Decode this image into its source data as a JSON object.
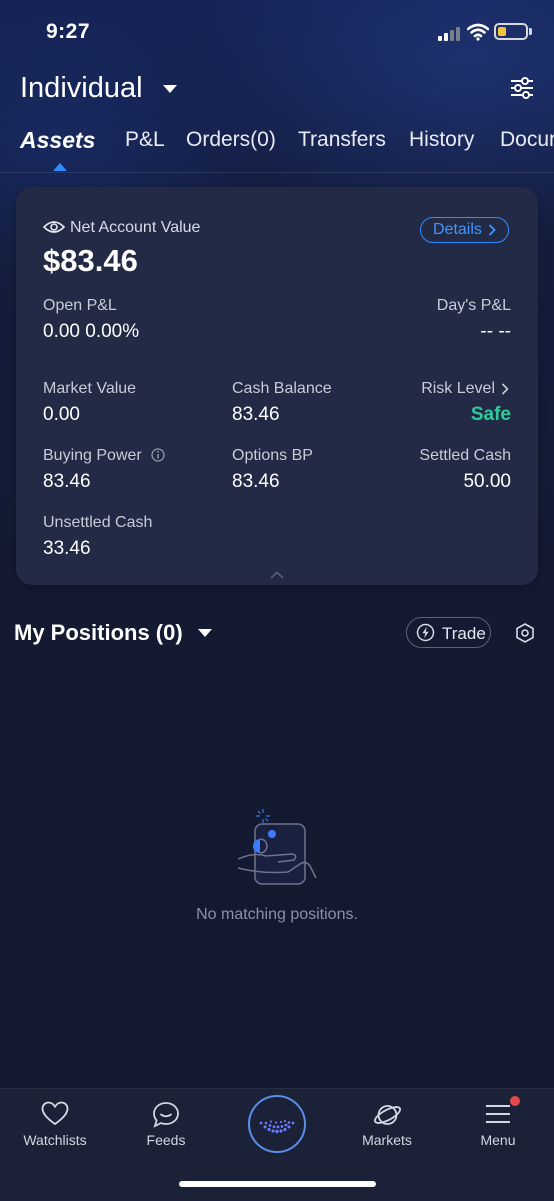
{
  "status_bar": {
    "time": "9:27"
  },
  "header": {
    "account_name": "Individual"
  },
  "tabs": [
    {
      "label": "Assets",
      "active": true
    },
    {
      "label": "P&L"
    },
    {
      "label": "Orders(0)"
    },
    {
      "label": "Transfers"
    },
    {
      "label": "History"
    },
    {
      "label": "Docur"
    }
  ],
  "account_card": {
    "net_value_label": "Net Account Value",
    "net_value": "$83.46",
    "details_label": "Details",
    "open_pl_label": "Open P&L",
    "open_pl_value": "0.00 0.00%",
    "days_pl_label": "Day's P&L",
    "days_pl_value": "-- --",
    "market_value_label": "Market Value",
    "market_value": "0.00",
    "cash_balance_label": "Cash Balance",
    "cash_balance": "83.46",
    "risk_level_label": "Risk Level",
    "risk_level": "Safe",
    "buying_power_label": "Buying Power",
    "buying_power": "83.46",
    "options_bp_label": "Options BP",
    "options_bp": "83.46",
    "settled_cash_label": "Settled Cash",
    "settled_cash": "50.00",
    "unsettled_cash_label": "Unsettled Cash",
    "unsettled_cash": "33.46"
  },
  "positions": {
    "title": "My Positions (0)",
    "trade_label": "Trade",
    "empty_message": "No matching positions."
  },
  "bottom_nav": [
    {
      "label": "Watchlists",
      "icon": "heart-icon"
    },
    {
      "label": "Feeds",
      "icon": "chat-bubble-icon"
    },
    {
      "label": "",
      "icon": "center-logo-icon"
    },
    {
      "label": "Markets",
      "icon": "planet-icon"
    },
    {
      "label": "Menu",
      "icon": "hamburger-menu-icon",
      "notification_dot": true
    }
  ],
  "colors": {
    "accent": "#2f8cff",
    "safe": "#2ecc9a",
    "background": "#131a30",
    "card": "#232a45",
    "battery": "#f3c33a",
    "notification": "#e5484d"
  }
}
